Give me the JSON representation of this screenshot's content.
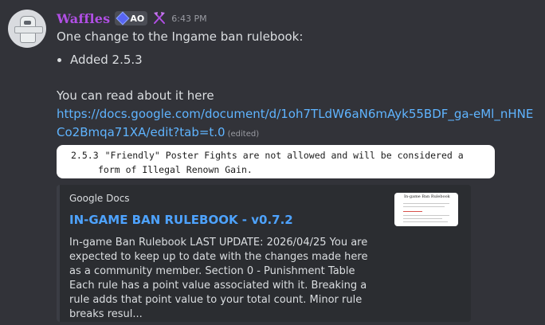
{
  "user": {
    "name": "Waffles",
    "tag_label": "AO",
    "timestamp": "6:43 PM"
  },
  "message": {
    "line1": "One change to the Ingame ban rulebook:",
    "bullet1": "Added 2.5.3",
    "line2": "You can read about it here",
    "link": "https://docs.google.com/document/d/1oh7TLdW6aN6mAyk55BDF_ga-eMl_nHNECo2Bmqa71XA/edit?tab=t.0",
    "edited": "(edited)"
  },
  "quote": {
    "number": "2.5.3",
    "text": "\"Friendly\" Poster Fights are not allowed and will be considered a form of Illegal Renown Gain."
  },
  "embed": {
    "provider": "Google Docs",
    "title": "IN-GAME BAN RULEBOOK - v0.7.2",
    "description": "In-game Ban Rulebook LAST UPDATE: 2026/04/25 You are expected to keep up to date with the changes made here as a community member. Section 0 - Punishment Table Each rule has a point value associated with it. Breaking a rule adds that point value to your total count. Minor rule breaks resul...",
    "thumbnail_title": "In-game Ban Rulebook"
  },
  "colors": {
    "background": "#323339",
    "username": "#b14fe5",
    "link": "#5fb4ff",
    "embed_title": "#4ea3ff",
    "embed_bg": "#2b2d31"
  },
  "icons": {
    "tag": "diamond-badge-icon",
    "role": "crossed-axes-icon"
  }
}
